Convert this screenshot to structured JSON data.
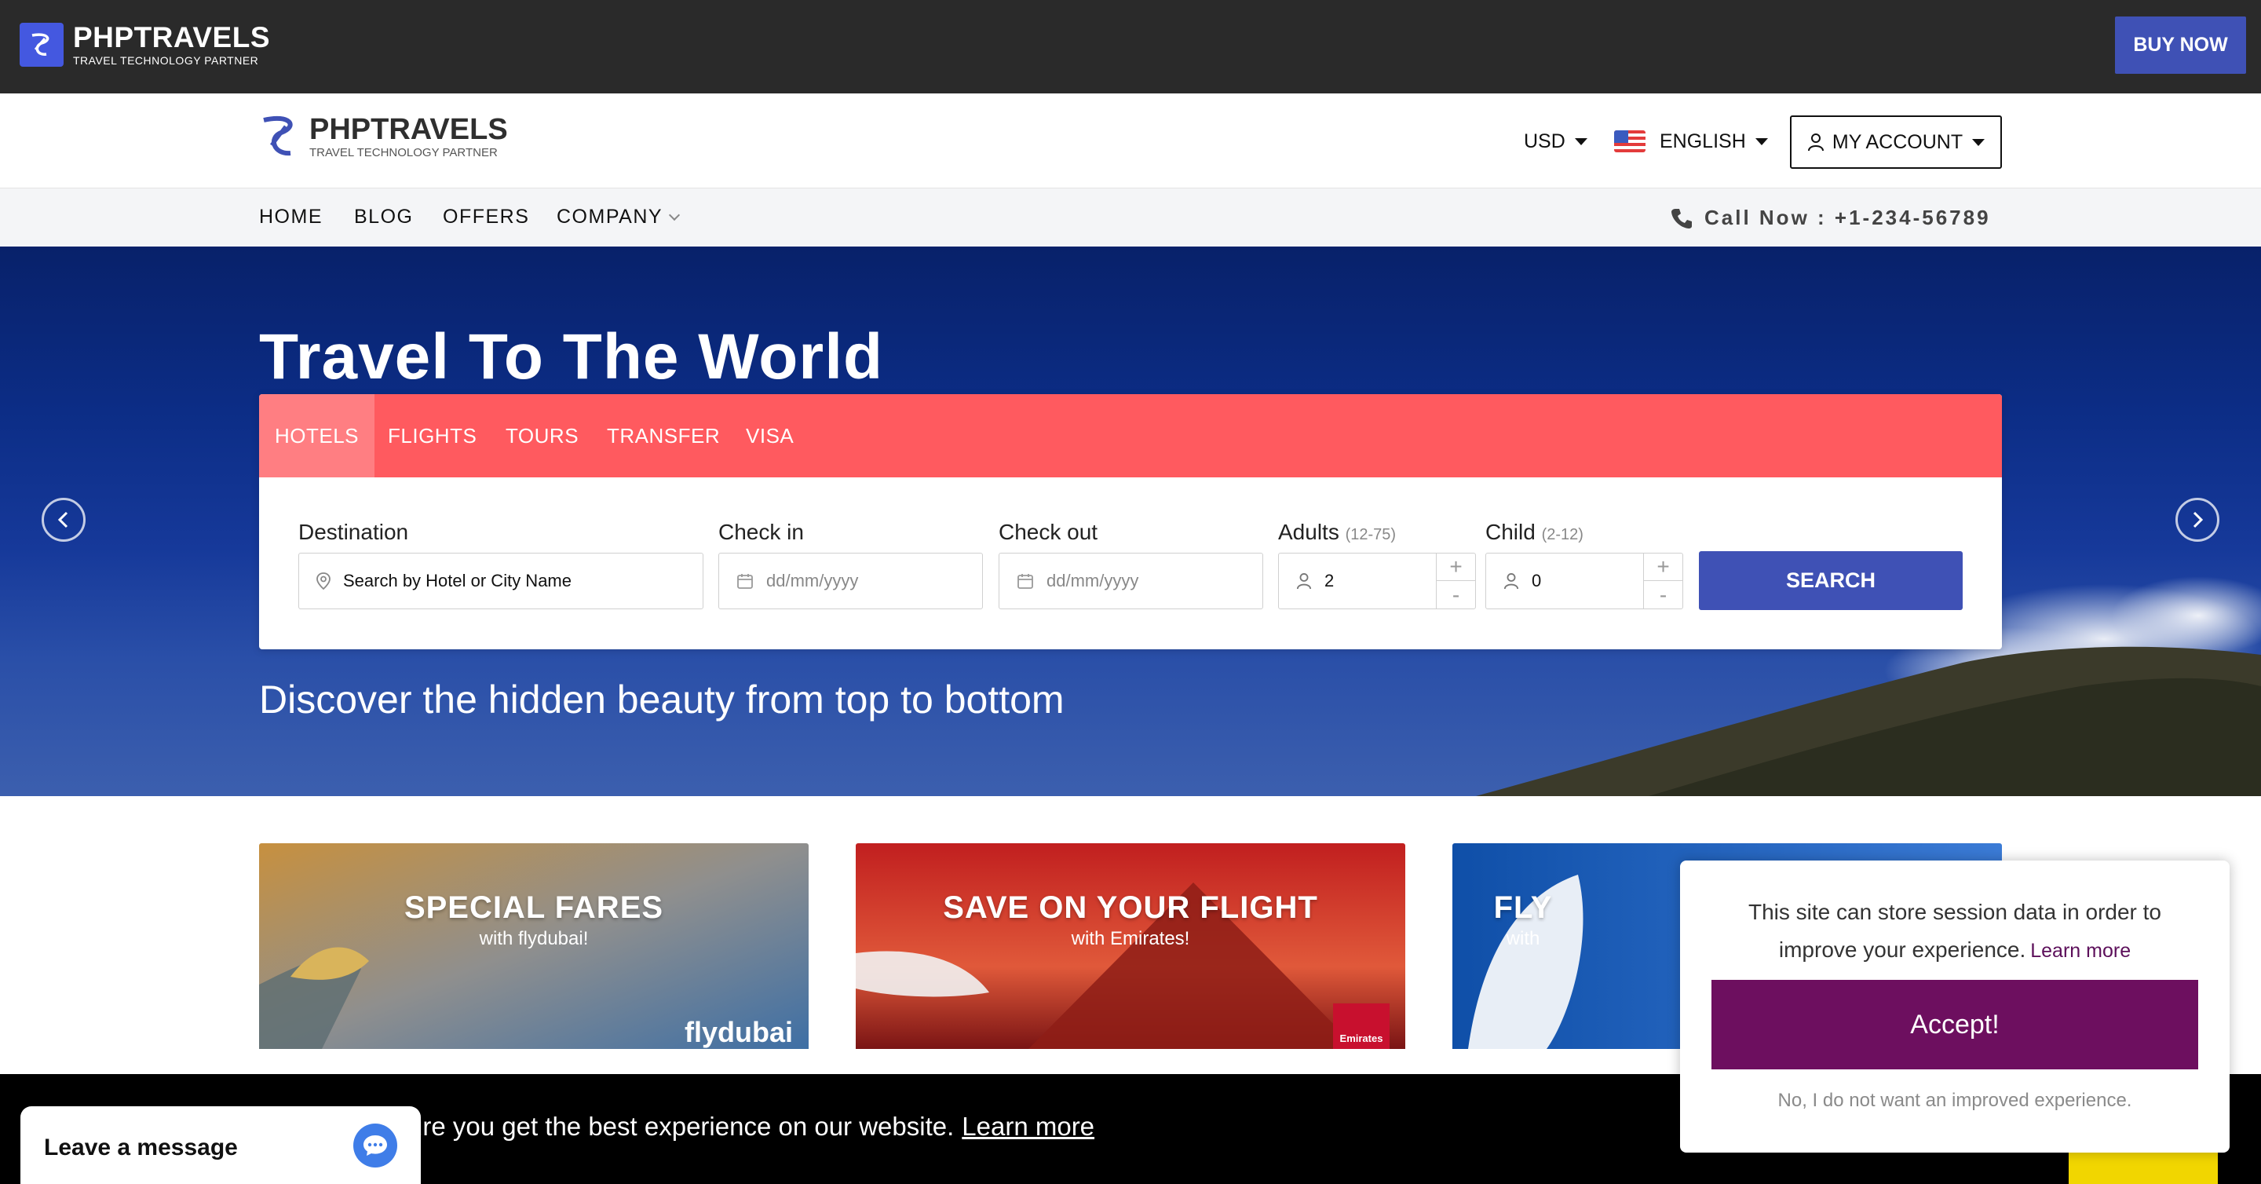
{
  "topbar": {
    "brand_name": "PHPTRAVELS",
    "brand_tagline": "TRAVEL TECHNOLOGY PARTNER",
    "buy_now_label": "BUY NOW"
  },
  "header": {
    "brand_name": "PHPTRAVELS",
    "brand_tagline": "TRAVEL TECHNOLOGY PARTNER",
    "currency": "USD",
    "language": "ENGLISH",
    "account_label": "MY ACCOUNT"
  },
  "nav": {
    "items": [
      "HOME",
      "BLOG",
      "OFFERS",
      "COMPANY"
    ],
    "call_now": "Call Now : +1-234-56789"
  },
  "hero": {
    "title": "Travel To The World",
    "subtitle": "Discover the hidden beauty from top to bottom"
  },
  "search": {
    "tabs": [
      "HOTELS",
      "FLIGHTS",
      "TOURS",
      "TRANSFER",
      "VISA"
    ],
    "active_tab": "HOTELS",
    "destination_label": "Destination",
    "destination_placeholder": "Search by Hotel or City Name",
    "checkin_label": "Check in",
    "checkin_placeholder": "dd/mm/yyyy",
    "checkout_label": "Check out",
    "checkout_placeholder": "dd/mm/yyyy",
    "adults_label": "Adults",
    "adults_range": "(12-75)",
    "adults_value": "2",
    "child_label": "Child",
    "child_range": "(2-12)",
    "child_value": "0",
    "plus": "+",
    "minus": "-",
    "search_label": "SEARCH"
  },
  "offers": [
    {
      "title": "SPECIAL FARES",
      "subtitle": "with flydubai!",
      "brand": "flydubai"
    },
    {
      "title": "SAVE ON YOUR FLIGHT",
      "subtitle": "with Emirates!",
      "brand": "Emirates"
    },
    {
      "title": "FLY",
      "subtitle": "with"
    }
  ],
  "cookie_bar": {
    "text": "ure you get the best experience on our website.",
    "link": "Learn more"
  },
  "chat": {
    "label": "Leave a message"
  },
  "consent": {
    "message": "This site can store session data in order to improve your experience.",
    "learn_more": "Learn more",
    "accept_label": "Accept!",
    "decline_label": "No, I do not want an improved experience."
  },
  "colors": {
    "topbar": "#2a2a2a",
    "primary": "#3f51b5",
    "tabs": "#ff5a5f",
    "accept": "#6d0f5f",
    "cookie_yellow": "#f1d600"
  }
}
